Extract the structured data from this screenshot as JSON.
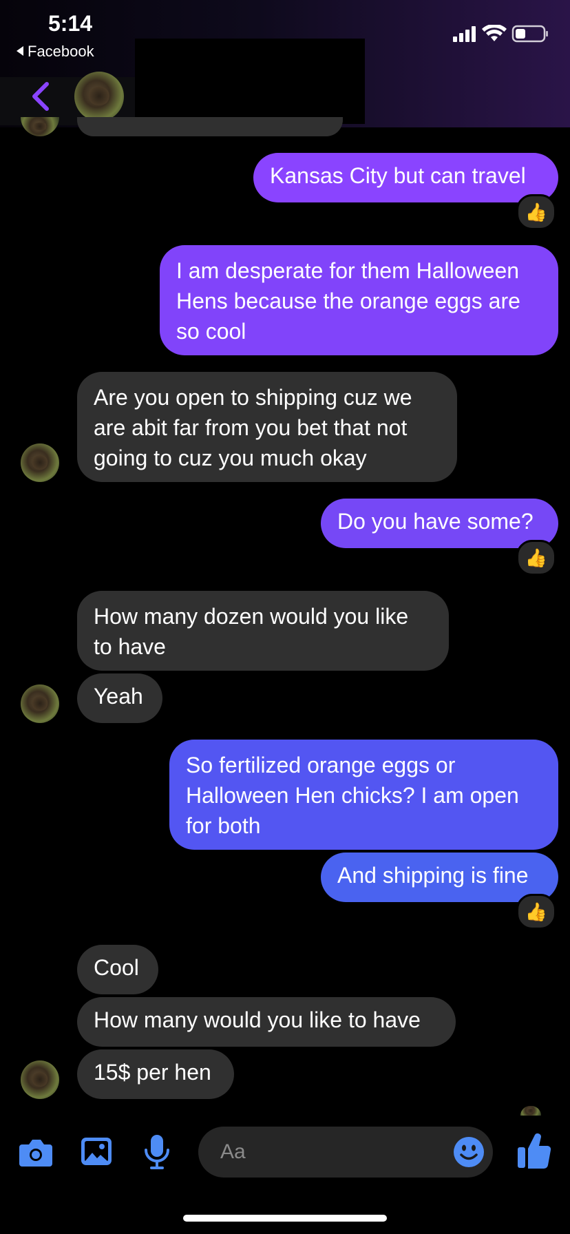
{
  "status_bar": {
    "time": "5:14",
    "back_label": "Facebook"
  },
  "header": {
    "back_icon": "chevron-left-icon",
    "accent": "#8a44ff"
  },
  "messages": [
    {
      "dir": "out",
      "text": "Kansas City but can travel",
      "reaction": "👍"
    },
    {
      "dir": "out",
      "text": "I am desperate for them Halloween Hens because the orange eggs are so cool"
    },
    {
      "dir": "in",
      "text": "Are you open to shipping cuz we are abit far from you bet that not going to cuz you much okay"
    },
    {
      "dir": "out",
      "text": "Do you have some?",
      "reaction": "👍"
    },
    {
      "dir": "in",
      "text": "How many dozen would you like to have"
    },
    {
      "dir": "in",
      "text": "Yeah"
    },
    {
      "dir": "out",
      "text": "So fertilized orange eggs or Halloween Hen chicks? I am open for both"
    },
    {
      "dir": "out",
      "text": "And shipping is fine",
      "reaction": "👍"
    },
    {
      "dir": "in",
      "text": "Cool"
    },
    {
      "dir": "in",
      "text": "How many would you like to have"
    },
    {
      "dir": "in",
      "text": "15$ per hen"
    }
  ],
  "composer": {
    "placeholder": "Aa",
    "icons": [
      "camera-icon",
      "gallery-icon",
      "microphone-icon",
      "emoji-icon",
      "thumbs-up-icon"
    ],
    "icon_color": "#4e8cf5"
  },
  "colors": {
    "outgoing_top": "#8a44ff",
    "outgoing_bottom": "#4a63f0",
    "incoming": "#303030",
    "background": "#000000"
  }
}
